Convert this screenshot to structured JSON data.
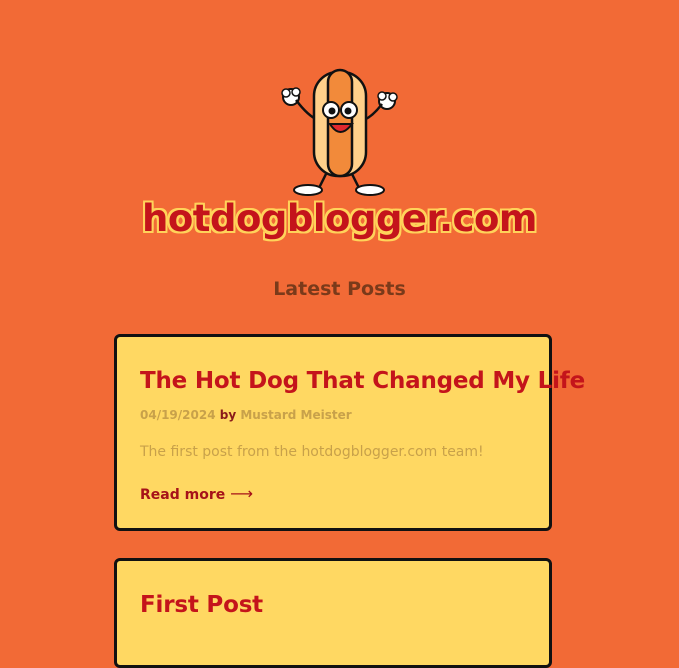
{
  "site": {
    "title": "hotdogblogger.com",
    "mascot_icon": "hotdog-mascot-icon"
  },
  "section": {
    "title": "Latest Posts"
  },
  "posts": [
    {
      "title": "The Hot Dog That Changed My Life",
      "date": "04/19/2024",
      "by": "by",
      "author": "Mustard Meister",
      "excerpt": "The first post from the hotdogblogger.com team!",
      "read_more": "Read more",
      "arrow": "⟶"
    },
    {
      "title": "First Post"
    }
  ],
  "colors": {
    "background": "#f26a36",
    "card": "#ffd862",
    "accent": "#c4141b"
  }
}
